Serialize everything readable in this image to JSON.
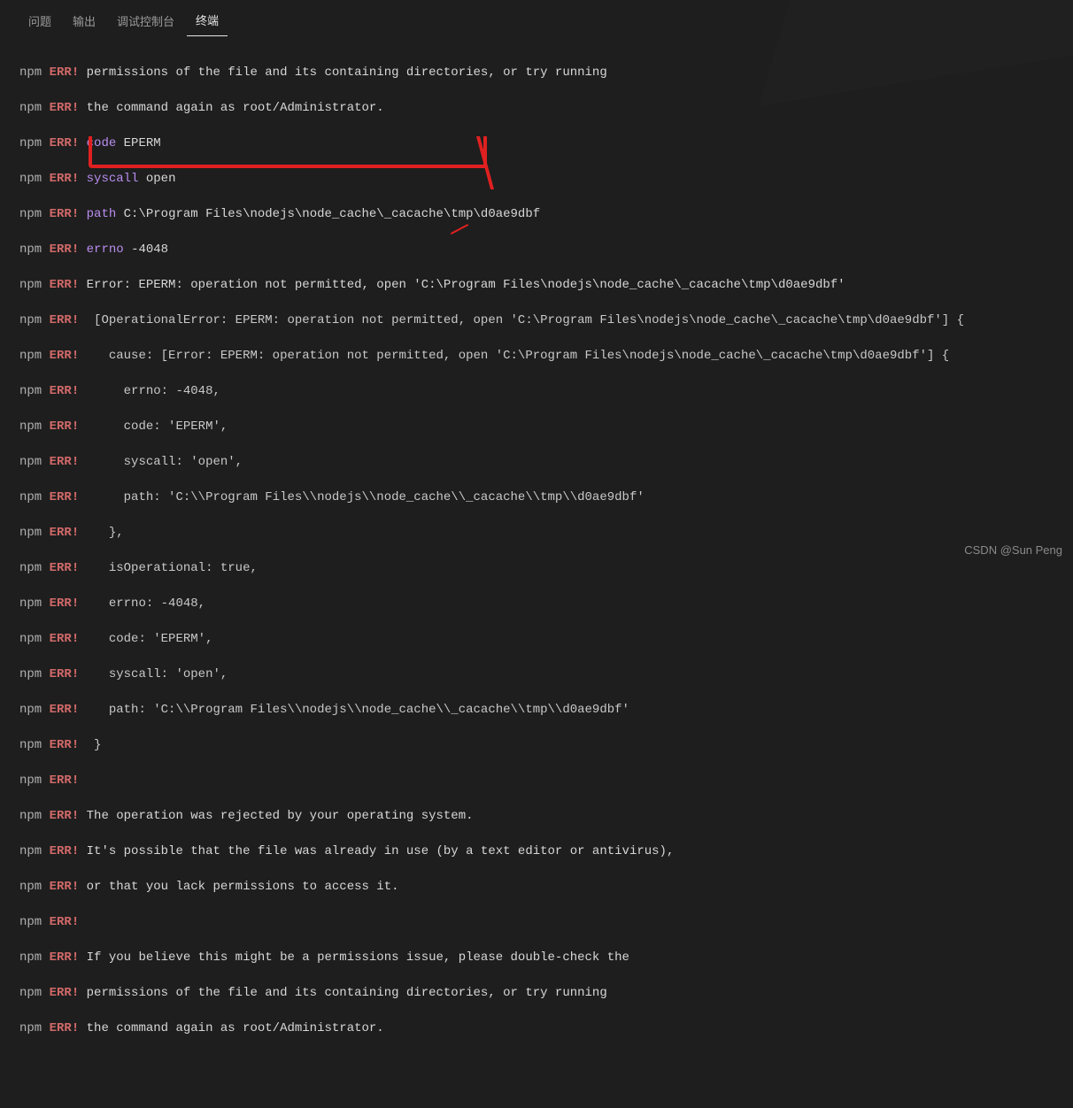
{
  "tabs": {
    "problems": "问题",
    "output": "输出",
    "debug": "调试控制台",
    "terminal": "终端"
  },
  "prefix": {
    "npm": "npm",
    "err": "ERR!"
  },
  "kw": {
    "code": "code",
    "syscall": "syscall",
    "path": "path",
    "errno": "errno"
  },
  "lines": {
    "l1": "permissions of the file and its containing directories, or try running",
    "l2": "the command again as root/Administrator.",
    "l3v": "EPERM",
    "l4v": "open",
    "l5v": "C:\\Program Files\\nodejs\\node_cache\\_cacache\\tmp\\d0ae9dbf",
    "l6v": "-4048",
    "l7": "Error: EPERM: operation not permitted, open 'C:\\Program Files\\nodejs\\node_cache\\_cacache\\tmp\\d0ae9dbf'",
    "l8": " [OperationalError: EPERM: operation not permitted, open 'C:\\Program Files\\nodejs\\node_cache\\_cacache\\tmp\\d0ae9dbf'] {",
    "l9": "   cause: [Error: EPERM: operation not permitted, open 'C:\\Program Files\\nodejs\\node_cache\\_cacache\\tmp\\d0ae9dbf'] {",
    "l10": "     errno: -4048,",
    "l11": "     code: 'EPERM',",
    "l12": "     syscall: 'open',",
    "l13": "     path: 'C:\\\\Program Files\\\\nodejs\\\\node_cache\\\\_cacache\\\\tmp\\\\d0ae9dbf'",
    "l14": "   },",
    "l15": "   isOperational: true,",
    "l16": "   errno: -4048,",
    "l17": "   code: 'EPERM',",
    "l18": "   syscall: 'open',",
    "l19": "   path: 'C:\\\\Program Files\\\\nodejs\\\\node_cache\\\\_cacache\\\\tmp\\\\d0ae9dbf'",
    "l20": " }",
    "l21": "",
    "l22": "The operation was rejected by your operating system.",
    "l23": "It's possible that the file was already in use (by a text editor or antivirus),",
    "l24": "or that you lack permissions to access it.",
    "l25": "",
    "l26": "If you believe this might be a permissions issue, please double-check the",
    "l27": "permissions of the file and its containing directories, or try running",
    "l28": "the command again as root/Administrator."
  },
  "watermark": "CSDN @Sun  Peng"
}
